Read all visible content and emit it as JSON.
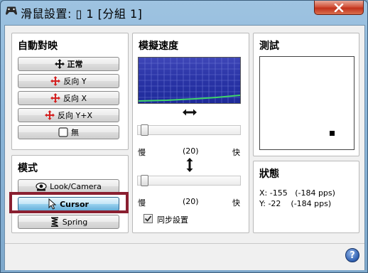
{
  "window": {
    "title": "滑鼠設置: ▯ 1 [分組 1]",
    "close_icon": "close-icon"
  },
  "auto_map": {
    "title": "自動對映",
    "buttons": [
      {
        "label": "正常",
        "icon": "four-way-arrows-icon"
      },
      {
        "label": "反向 Y",
        "icon": "red-arrows-icon"
      },
      {
        "label": "反向 X",
        "icon": "red-arrows-icon"
      },
      {
        "label": "反向 Y+X",
        "icon": "red-arrows-icon"
      },
      {
        "label": "無",
        "icon": "empty-box-icon"
      }
    ]
  },
  "mode": {
    "title": "模式",
    "buttons": [
      {
        "label": "Look/Camera",
        "icon": "eye-icon"
      },
      {
        "label": "Cursor",
        "icon": "cursor-icon"
      },
      {
        "label": "Spring",
        "icon": "spring-icon"
      }
    ],
    "selected": "Cursor"
  },
  "speed": {
    "title": "模擬速度",
    "horizontal": {
      "min_label": "慢",
      "value_label": "(20)",
      "max_label": "快",
      "value_fraction": 0.02
    },
    "vertical": {
      "min_label": "慢",
      "value_label": "(20)",
      "max_label": "快",
      "value_fraction": 0.02
    },
    "sync_label": "同步設置",
    "sync_checked": true
  },
  "test": {
    "title": "測試"
  },
  "status": {
    "title": "狀態",
    "x_line": "X: -155   (-184 pps)",
    "y_line": "Y: -22    (-184 pps)"
  },
  "help": {
    "label": "?"
  },
  "colors": {
    "selected_button": "#98d1ef",
    "highlight_border": "#8a1f30",
    "graph_background": "#2c36a8",
    "graph_curve": "#3fd46a"
  }
}
